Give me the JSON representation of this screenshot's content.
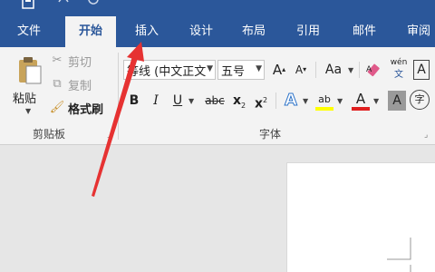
{
  "ribbon_tabs": {
    "file": "文件",
    "home": "开始",
    "insert": "插入",
    "design": "设计",
    "layout": "布局",
    "references": "引用",
    "mailings": "邮件",
    "review": "审阅"
  },
  "clipboard": {
    "paste": "粘贴",
    "cut": "剪切",
    "copy": "复制",
    "format_painter": "格式刷",
    "group_label": "剪贴板"
  },
  "font": {
    "font_name": "等线 (中文正文",
    "font_size": "五号",
    "group_label": "字体",
    "grow_label": "A",
    "shrink_label": "A",
    "change_case_label": "Aa",
    "bold": "B",
    "italic": "I",
    "underline": "U",
    "strikethrough": "abc",
    "subscript_base": "x",
    "subscript_sub": "2",
    "superscript_base": "x",
    "superscript_sup": "2",
    "text_effects_label": "A",
    "highlight_label": "ab",
    "font_color_label": "A",
    "char_shading_label": "A",
    "enclose_char_label": "字",
    "phonetic_top": "wén",
    "phonetic_bottom": "文",
    "char_border_label": "A"
  },
  "colors": {
    "title_bar": "#2b579a",
    "ribbon": "#f3f3f3",
    "highlight_yellow": "#ffff00",
    "font_color_red": "#e02020",
    "annotation_arrow": "#e63232"
  }
}
